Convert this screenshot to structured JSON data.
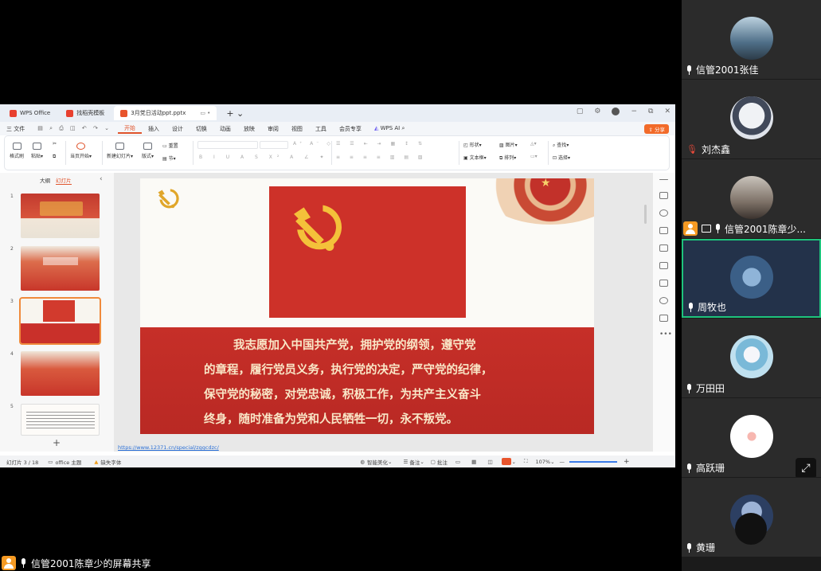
{
  "wps": {
    "tabs": [
      {
        "label": "WPS Office"
      },
      {
        "label": "找稻壳模板"
      },
      {
        "label": "3月党日活动ppt.pptx"
      }
    ],
    "menu": [
      "三 文件",
      "开始",
      "插入",
      "设计",
      "切换",
      "动画",
      "放映",
      "审阅",
      "视图",
      "工具",
      "会员专享",
      "WPS AI"
    ],
    "share_label": "分享",
    "ribbon": {
      "format_painter": "格式刷",
      "paste": "粘贴",
      "play_from_current": "当页开始",
      "new_slide": "新建幻灯片",
      "layout": "版式",
      "reset": "重置",
      "section": "节",
      "shape": "形状",
      "picture": "图片",
      "textbox": "文本框",
      "arrange": "排列",
      "find": "查找",
      "select": "选择"
    },
    "left_pane": {
      "outline_tab": "大纲",
      "slides_tab": "幻灯片",
      "add_label": "+"
    },
    "thumbnails": [
      "1",
      "2",
      "3",
      "4",
      "5"
    ],
    "slide": {
      "oath_lines": [
        "我志愿加入中国共产党，拥护党的纲领，遵守党",
        "的章程，履行党员义务，执行党的决定，严守党的纪律，",
        "保守党的秘密，对党忠诚，积极工作，为共产主义奋斗",
        "终身，随时准备为党和人民牺牲一切，永不叛党。"
      ],
      "url": "https://www.12371.cn/special/zggcdzc/"
    },
    "status": {
      "slide_counter": "幻灯片 3 / 18",
      "theme": "office 主题",
      "missing_font": "缺失字体",
      "beautify": "智能美化",
      "notes": "备注",
      "comments": "批注",
      "zoom": "107%"
    }
  },
  "participants": [
    {
      "name": "信管2001张佳",
      "avatar_color": "#6f8fa6"
    },
    {
      "name": "刘杰鑫",
      "avatar_color": "#dfe3ea"
    },
    {
      "name": "信管2001陈章少...",
      "avatar_color": "#9a8f86"
    },
    {
      "name": "周牧也",
      "avatar_color": "#3b5f87"
    },
    {
      "name": "万田田",
      "avatar_color": "#bfe0ef"
    },
    {
      "name": "高跃珊",
      "avatar_color": "#ffffff"
    },
    {
      "name": "黄珊",
      "avatar_color": "#2c3f62"
    }
  ],
  "screen_share_label": "信管2001陈章少的屏幕共享",
  "colors": {
    "party_red": "#c9302a",
    "accent_orange": "#e0542c",
    "emblem_gold": "#f4c13a"
  }
}
